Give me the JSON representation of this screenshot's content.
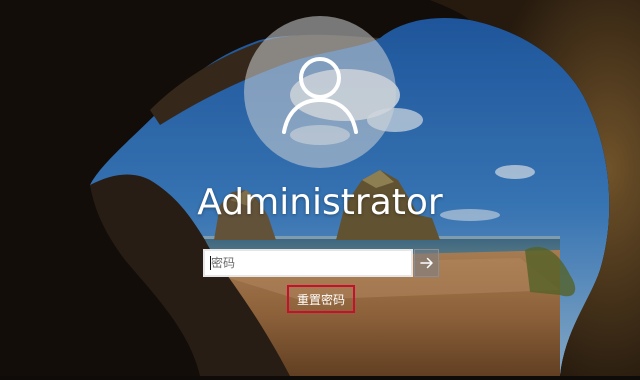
{
  "user": {
    "name": "Administrator",
    "avatar_icon": "user-silhouette-icon"
  },
  "password": {
    "placeholder": "密码",
    "value": ""
  },
  "submit": {
    "icon": "arrow-right-icon"
  },
  "reset_link": {
    "label": "重置密码",
    "highlight_color": "#c8102e"
  },
  "background": {
    "scene": "sea-cave-beach-wallpaper"
  }
}
